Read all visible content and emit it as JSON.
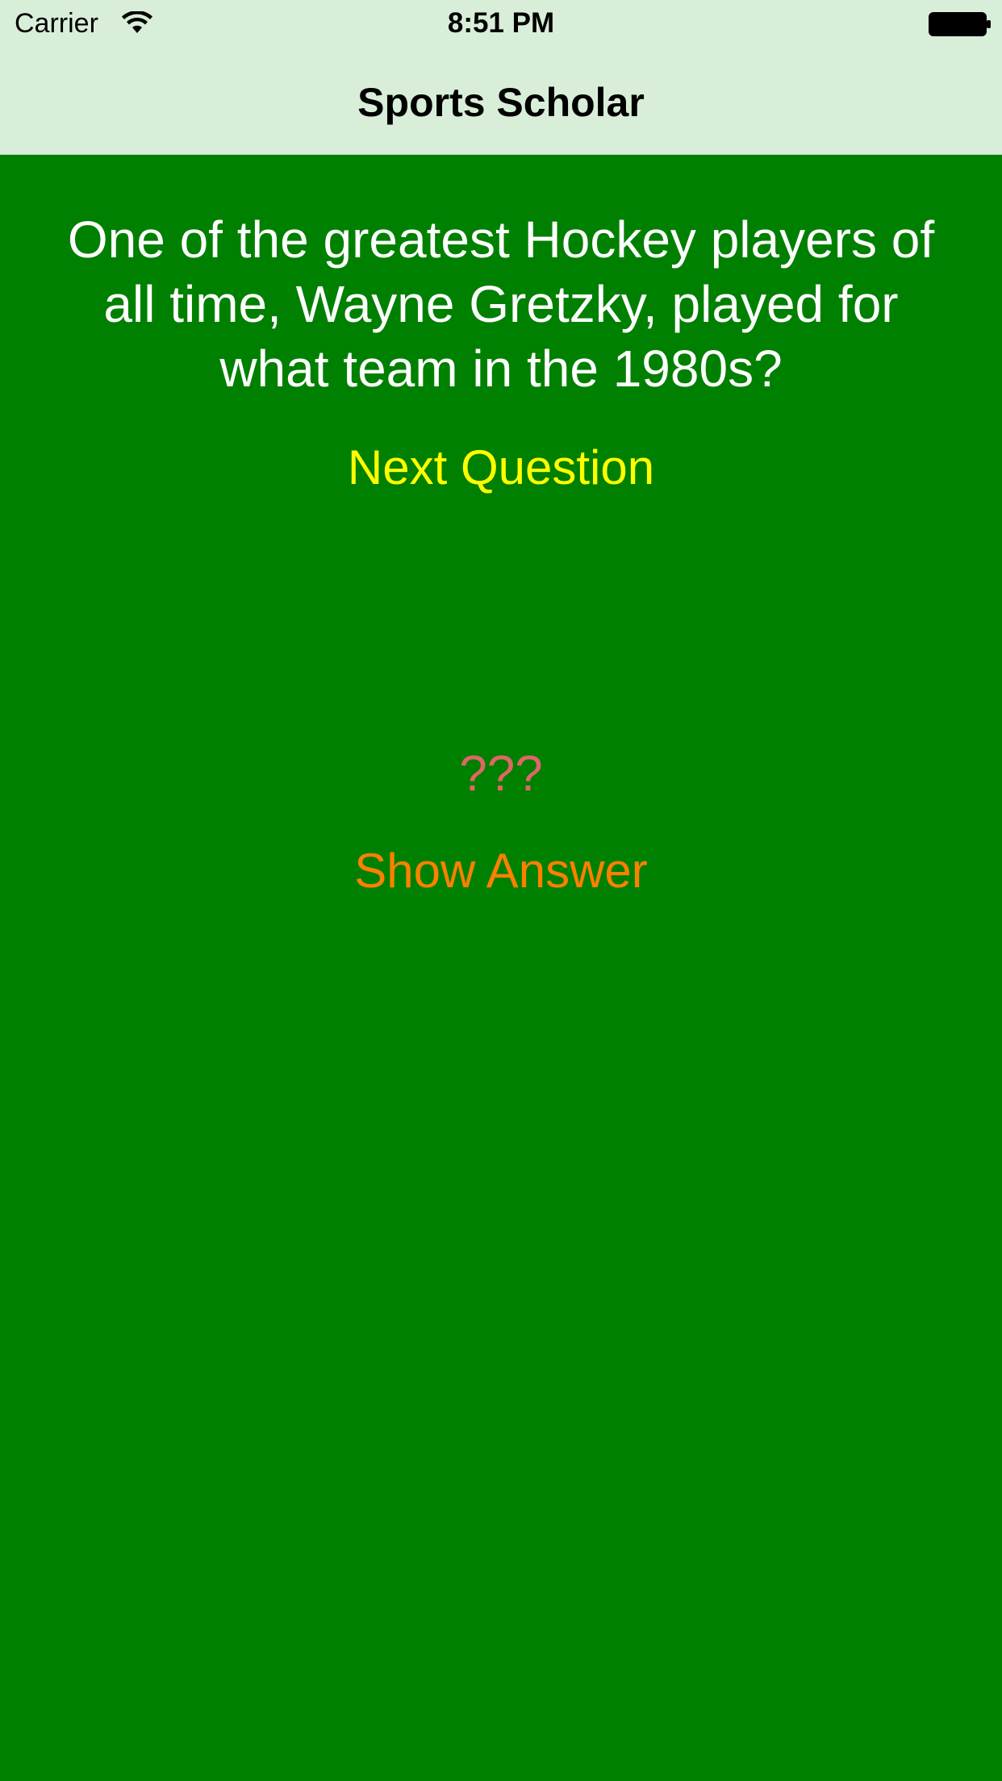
{
  "status_bar": {
    "carrier": "Carrier",
    "time": "8:51 PM",
    "wifi_icon": "wifi-icon",
    "battery_icon": "battery-full-icon"
  },
  "nav": {
    "title": "Sports Scholar"
  },
  "quiz": {
    "question": "One of the greatest Hockey players of all time, Wayne Gretzky, played for what team in the 1980s?",
    "next_label": "Next Question",
    "answer": "???",
    "show_answer_label": "Show Answer"
  },
  "colors": {
    "background": "#008000",
    "nav_background": "#d8eed8",
    "question": "#ffffff",
    "next_button": "#ffff00",
    "answer": "#e06666",
    "show_answer_button": "#ff8000"
  }
}
